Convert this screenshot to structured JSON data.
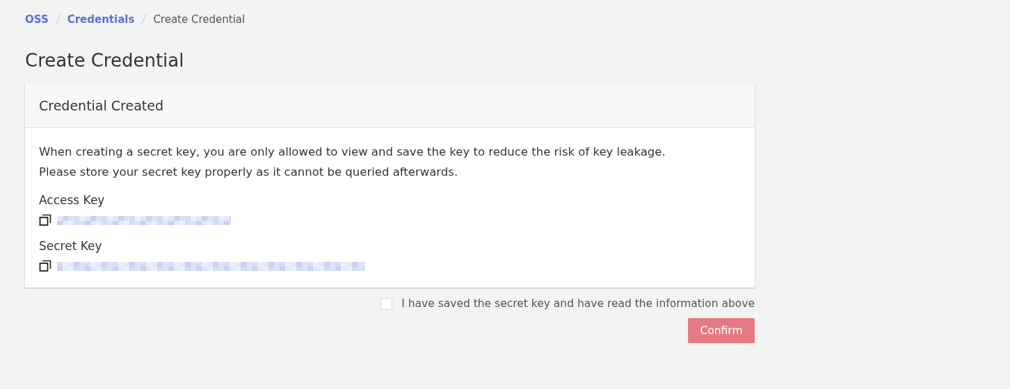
{
  "breadcrumb": [
    {
      "label": "OSS",
      "kind": "link"
    },
    {
      "label": "Credentials",
      "kind": "link"
    },
    {
      "label": "Create Credential",
      "kind": "current"
    }
  ],
  "page_title": "Create Credential",
  "card": {
    "title": "Credential Created",
    "notice": [
      "When creating a secret key, you are only allowed to view and save the key to reduce the risk of key leakage.",
      "Please store your secret key properly as it cannot be queried afterwards."
    ],
    "keys": [
      {
        "label": "Access Key",
        "kind": "redacted"
      },
      {
        "label": "Secret Key",
        "kind": "redacted"
      }
    ]
  },
  "acknowledge": {
    "label": "I have saved the secret key and have read the information above",
    "checked": false
  },
  "confirm_button": {
    "label": "Confirm",
    "disabled": true
  }
}
